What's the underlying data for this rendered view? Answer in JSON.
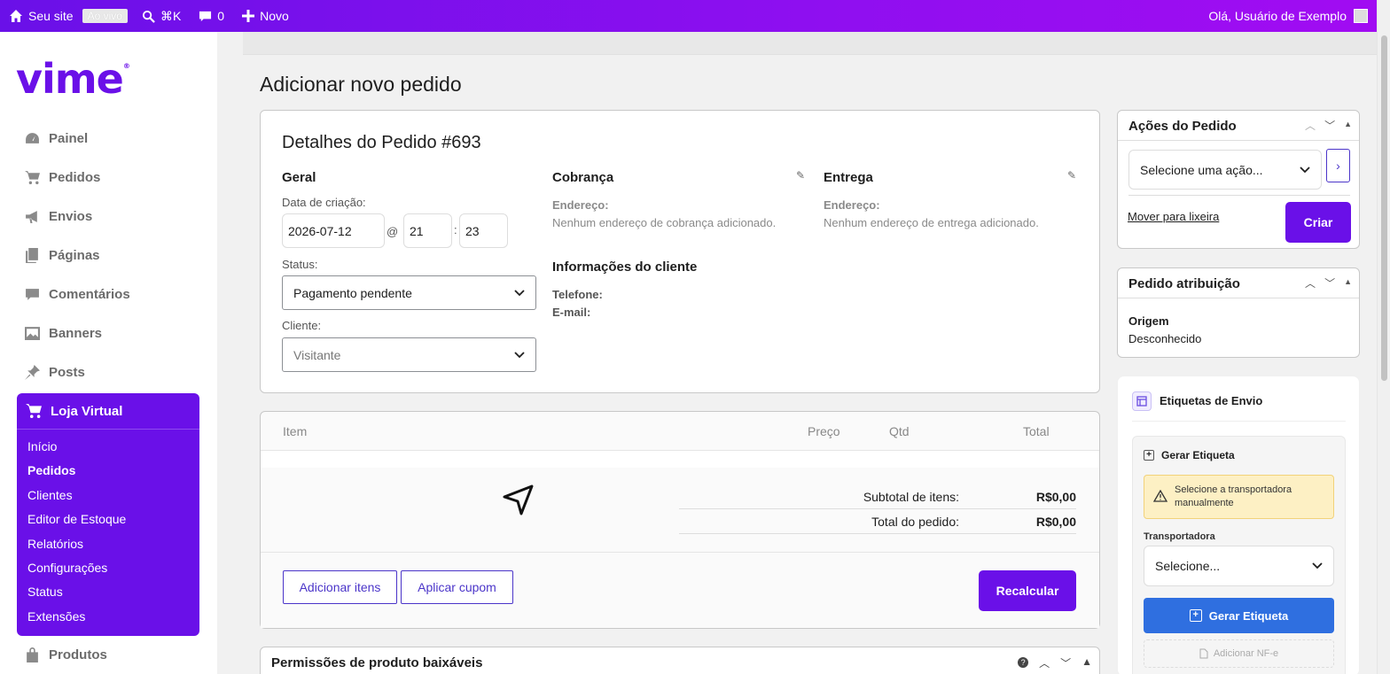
{
  "admin_bar": {
    "site_label": "Seu site",
    "live_badge": "Ao vivo",
    "search_shortcut": "⌘K",
    "comments_count": "0",
    "new_label": "Novo",
    "greeting": "Olá, Usuário de Exemplo"
  },
  "sidebar": {
    "logo": "vime",
    "logo_mark": "®",
    "items": [
      {
        "label": "Painel",
        "icon": "dashboard-icon"
      },
      {
        "label": "Pedidos",
        "icon": "cart-icon"
      },
      {
        "label": "Envios",
        "icon": "megaphone-icon"
      },
      {
        "label": "Páginas",
        "icon": "pages-icon"
      },
      {
        "label": "Comentários",
        "icon": "comment-icon"
      },
      {
        "label": "Banners",
        "icon": "image-icon"
      },
      {
        "label": "Posts",
        "icon": "pin-icon"
      }
    ],
    "store": {
      "label": "Loja Virtual",
      "sub": [
        "Início",
        "Pedidos",
        "Clientes",
        "Editor de Estoque",
        "Relatórios",
        "Configurações",
        "Status",
        "Extensões"
      ]
    },
    "products_label": "Produtos"
  },
  "page": {
    "title": "Adicionar novo pedido"
  },
  "order": {
    "title": "Detalhes do Pedido #693",
    "general": {
      "heading": "Geral",
      "date_label": "Data de criação:",
      "date": "2026-07-12",
      "at": "@",
      "hour": "21",
      "colon": ":",
      "minute": "23",
      "status_label": "Status:",
      "status_value": "Pagamento pendente",
      "customer_label": "Cliente:",
      "customer_value": "Visitante"
    },
    "billing": {
      "heading": "Cobrança",
      "address_label": "Endereço:",
      "address_value": "Nenhum endereço de cobrança adicionado.",
      "client_info_heading": "Informações do cliente",
      "phone_label": "Telefone:",
      "email_label": "E-mail:"
    },
    "shipping": {
      "heading": "Entrega",
      "address_label": "Endereço:",
      "address_value": "Nenhum endereço de entrega adicionado."
    }
  },
  "items": {
    "columns": {
      "item": "Item",
      "price": "Preço",
      "qty": "Qtd",
      "total": "Total"
    },
    "subtotal_label": "Subtotal de itens:",
    "subtotal_value": "R$0,00",
    "total_label": "Total do pedido:",
    "total_value": "R$0,00",
    "add_items": "Adicionar itens",
    "apply_coupon": "Aplicar cupom",
    "recalculate": "Recalcular"
  },
  "permissions": {
    "title": "Permissões de produto baixáveis"
  },
  "actions": {
    "title": "Ações do Pedido",
    "select_placeholder": "Selecione uma ação...",
    "trash_link": "Mover para lixeira",
    "create": "Criar"
  },
  "attribution": {
    "title": "Pedido atribuição",
    "origin_label": "Origem",
    "origin_value": "Desconhecido"
  },
  "shipping_labels": {
    "title": "Etiquetas de Envio",
    "generate_heading": "Gerar Etiqueta",
    "warning": "Selecione a transportadora manualmente",
    "carrier_label": "Transportadora",
    "carrier_placeholder": "Selecione...",
    "generate_button": "Gerar Etiqueta",
    "add_nfe": "Adicionar NF-e"
  },
  "colors": {
    "brand": "#6a10e8",
    "blue": "#2f6fe0",
    "warning_bg": "#fdf0c4"
  }
}
